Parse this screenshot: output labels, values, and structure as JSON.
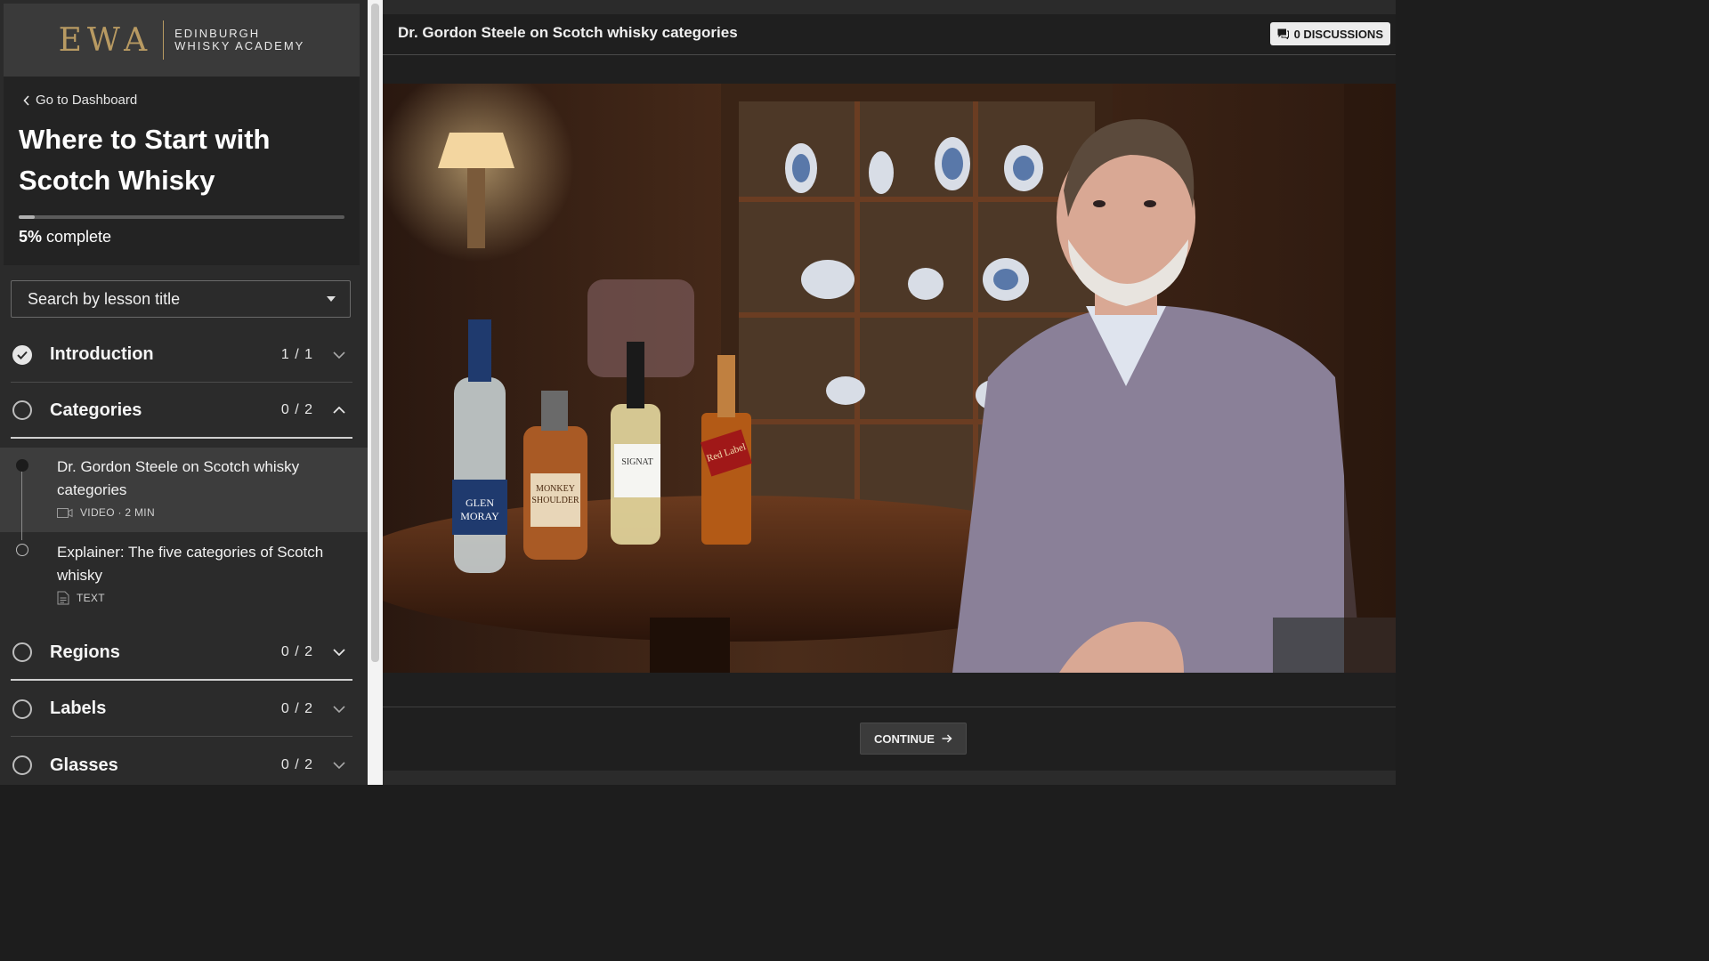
{
  "brand": {
    "mark": "EWA",
    "line1": "EDINBURGH",
    "line2": "WHISKY ACADEMY",
    "accent": "#b89a62"
  },
  "course": {
    "back_label": "Go to Dashboard",
    "title_line1": "Where to Start with",
    "title_line2": "Scotch Whisky",
    "progress_percent": 5,
    "progress_value": "5%",
    "progress_suffix": " complete"
  },
  "search": {
    "label": "Search by lesson title"
  },
  "sections": [
    {
      "name": "Introduction",
      "count": "1 / 1",
      "done": true,
      "expanded": false
    },
    {
      "name": "Categories",
      "count": "0 / 2",
      "done": false,
      "expanded": true
    },
    {
      "name": "Regions",
      "count": "0 / 2",
      "done": false,
      "expanded": false
    },
    {
      "name": "Labels",
      "count": "0 / 2",
      "done": false,
      "expanded": false
    },
    {
      "name": "Glasses",
      "count": "0 / 2",
      "done": false,
      "expanded": false
    }
  ],
  "lessons": [
    {
      "title": "Dr. Gordon Steele on Scotch whisky categories",
      "type": "VIDEO",
      "meta": "VIDEO · 2 MIN",
      "icon": "video-camera-icon",
      "active": true
    },
    {
      "title": "Explainer: The five categories of Scotch whisky",
      "type": "TEXT",
      "meta": "TEXT",
      "icon": "document-icon",
      "active": false
    }
  ],
  "main": {
    "heading": "Dr. Gordon Steele on Scotch whisky categories",
    "discussions_label": "0 DISCUSSIONS",
    "continue_label": "CONTINUE"
  },
  "video": {
    "bottles": [
      {
        "label_line1": "GLEN",
        "label_line2": "MORAY"
      },
      {
        "label_line1": "MONKEY",
        "label_line2": "SHOULDER"
      },
      {
        "label_line1": "SIGNAT",
        "label_line2": ""
      },
      {
        "label_line1": "Red Label",
        "label_line2": ""
      }
    ]
  }
}
